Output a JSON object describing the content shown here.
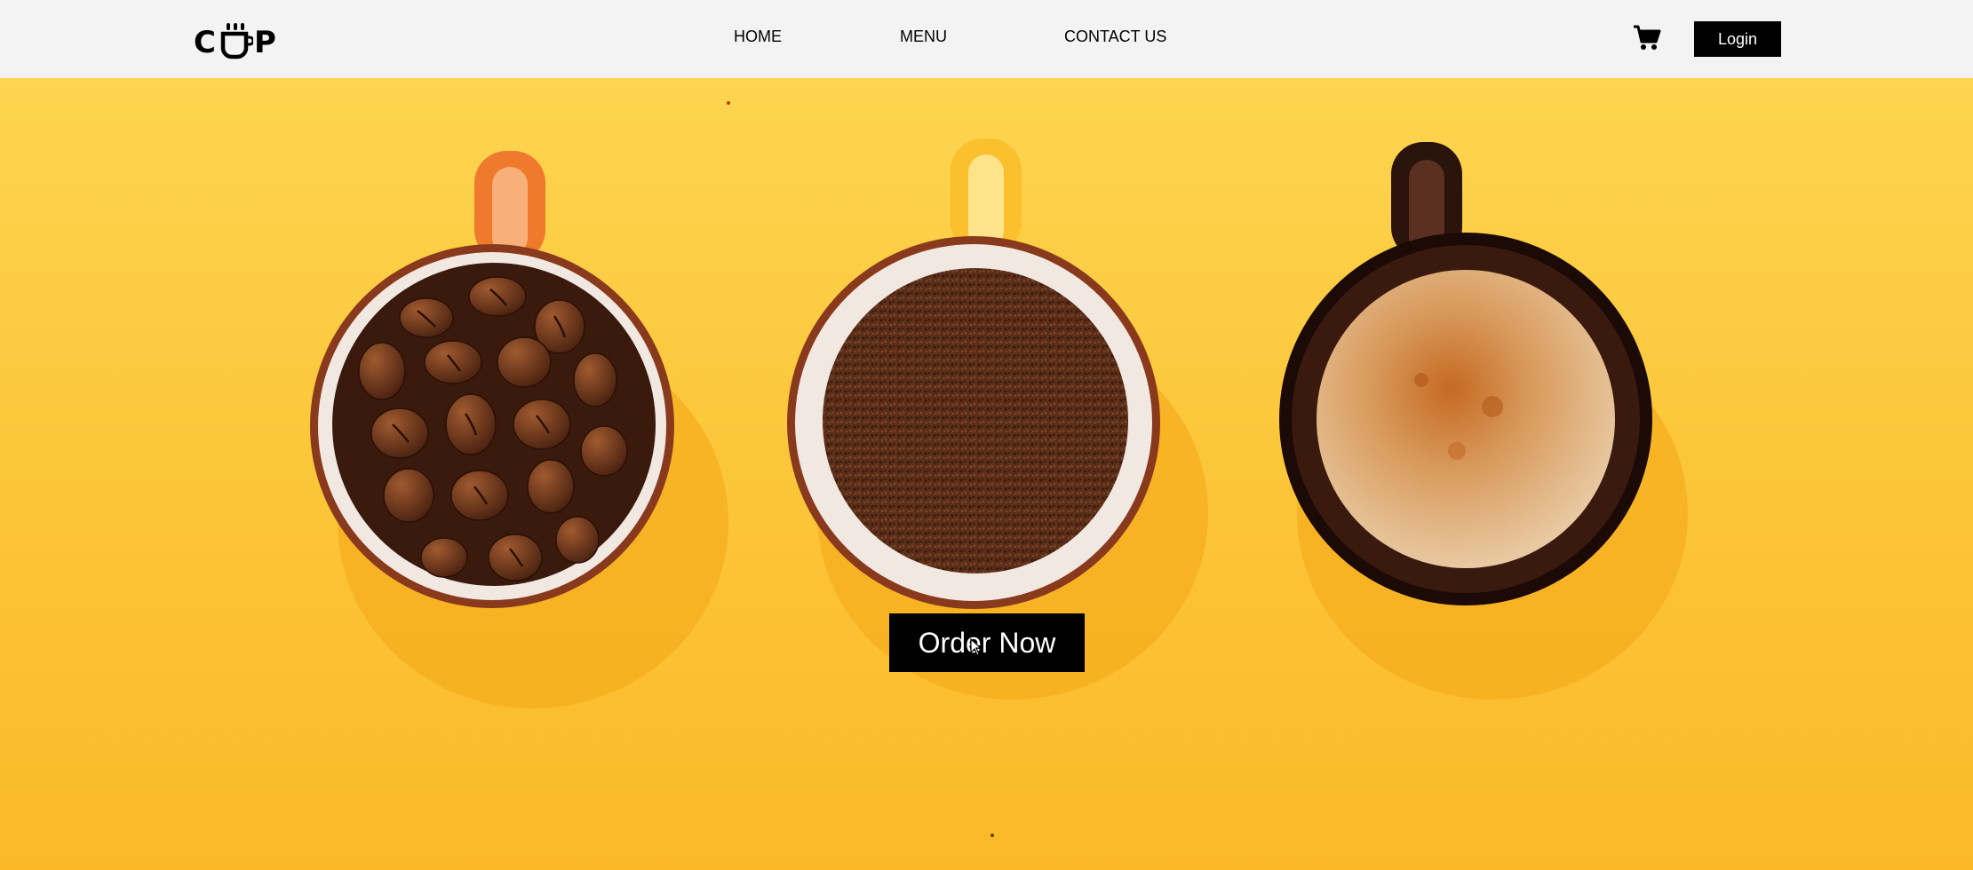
{
  "brand": {
    "logo_left": "C",
    "logo_right": "P"
  },
  "nav": {
    "links": [
      {
        "label": "HOME"
      },
      {
        "label": "MENU"
      },
      {
        "label": "CONTACT US"
      }
    ]
  },
  "header": {
    "cart_icon": "shopping-cart-icon",
    "login_label": "Login"
  },
  "hero": {
    "background_color": "#fcc73b",
    "cups": [
      {
        "contents": "coffee beans",
        "handle_color": "#ef7a2c"
      },
      {
        "contents": "ground coffee",
        "handle_color": "#fbc02d"
      },
      {
        "contents": "espresso",
        "handle_color": "#2b140c"
      }
    ],
    "cta_label": "Order Now"
  }
}
